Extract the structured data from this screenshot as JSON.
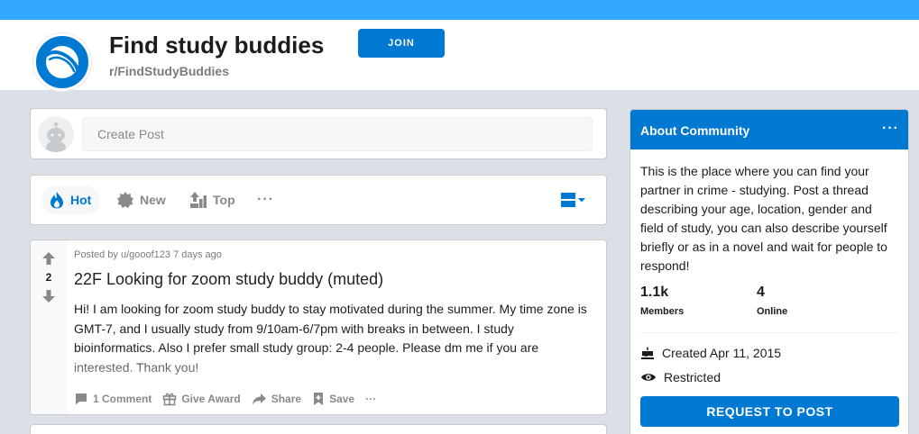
{
  "header": {
    "title": "Find study buddies",
    "subreddit": "r/FindStudyBuddies",
    "join_label": "JOIN",
    "accent_color": "#0079d3",
    "banner_color": "#33a8ff"
  },
  "create_post": {
    "placeholder": "Create Post"
  },
  "sort_bar": {
    "hot_label": "Hot",
    "new_label": "New",
    "top_label": "Top",
    "more_label": "···",
    "icons": [
      "flame-icon",
      "new-icon",
      "top-icon",
      "view-card-icon"
    ]
  },
  "post": {
    "votes": "2",
    "meta": "Posted by u/gooof123 7 days ago",
    "title": "22F Looking for zoom study buddy (muted)",
    "body": "Hi! I am looking for zoom study buddy to stay motivated during the summer. My time zone is GMT-7, and I usually study from 9/10am-6/7pm with breaks in between. I study bioinformatics. Also I prefer small study group: 2-4 people. Please dm me if you are interested. Thank you!",
    "actions": {
      "comments": "1 Comment",
      "award": "Give Award",
      "share": "Share",
      "save": "Save",
      "more": "···"
    }
  },
  "about": {
    "title": "About Community",
    "more": "···",
    "description": "This is the place where you can find your partner in crime - studying. Post a thread describing your age, location, gender and field of study, you can also describe yourself briefly or as in a novel and wait for people to respond!",
    "members_value": "1.1k",
    "members_label": "Members",
    "online_value": "4",
    "online_label": "Online",
    "created": "Created Apr 11, 2015",
    "restricted": "Restricted",
    "request_label": "REQUEST TO POST"
  }
}
